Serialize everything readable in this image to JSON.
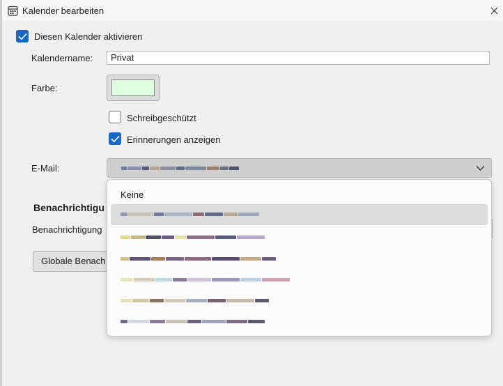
{
  "window": {
    "title": "Kalender bearbeiten"
  },
  "enable": {
    "label": "Diesen Kalender aktivieren",
    "checked": true
  },
  "form": {
    "name_label": "Kalendername:",
    "name_value": "Privat",
    "color_label": "Farbe:",
    "color_value": "#ddffdd",
    "readonly_label": "Schreibgeschützt",
    "readonly_checked": false,
    "reminders_label": "Erinnerungen anzeigen",
    "reminders_checked": true,
    "email_label": "E-Mail:"
  },
  "notifications": {
    "section_title": "Benachrichtigu",
    "field_label": "Benachrichtigung",
    "global_button": "Globale Benach"
  },
  "dropdown": {
    "options": [
      {
        "label": "Keine"
      },
      {
        "label": "",
        "redacted": true,
        "hovered": true
      },
      {
        "label": "",
        "redacted": true
      },
      {
        "label": "",
        "redacted": true
      },
      {
        "label": "",
        "redacted": true
      },
      {
        "label": "",
        "redacted": true
      }
    ]
  },
  "colors": {
    "accent": "#1868c4",
    "swatch": "#ddffdd"
  },
  "icons": {
    "title": "calendar-icon",
    "close": "close-icon",
    "check": "checkmark-icon",
    "select": "chevron-down-icon"
  }
}
